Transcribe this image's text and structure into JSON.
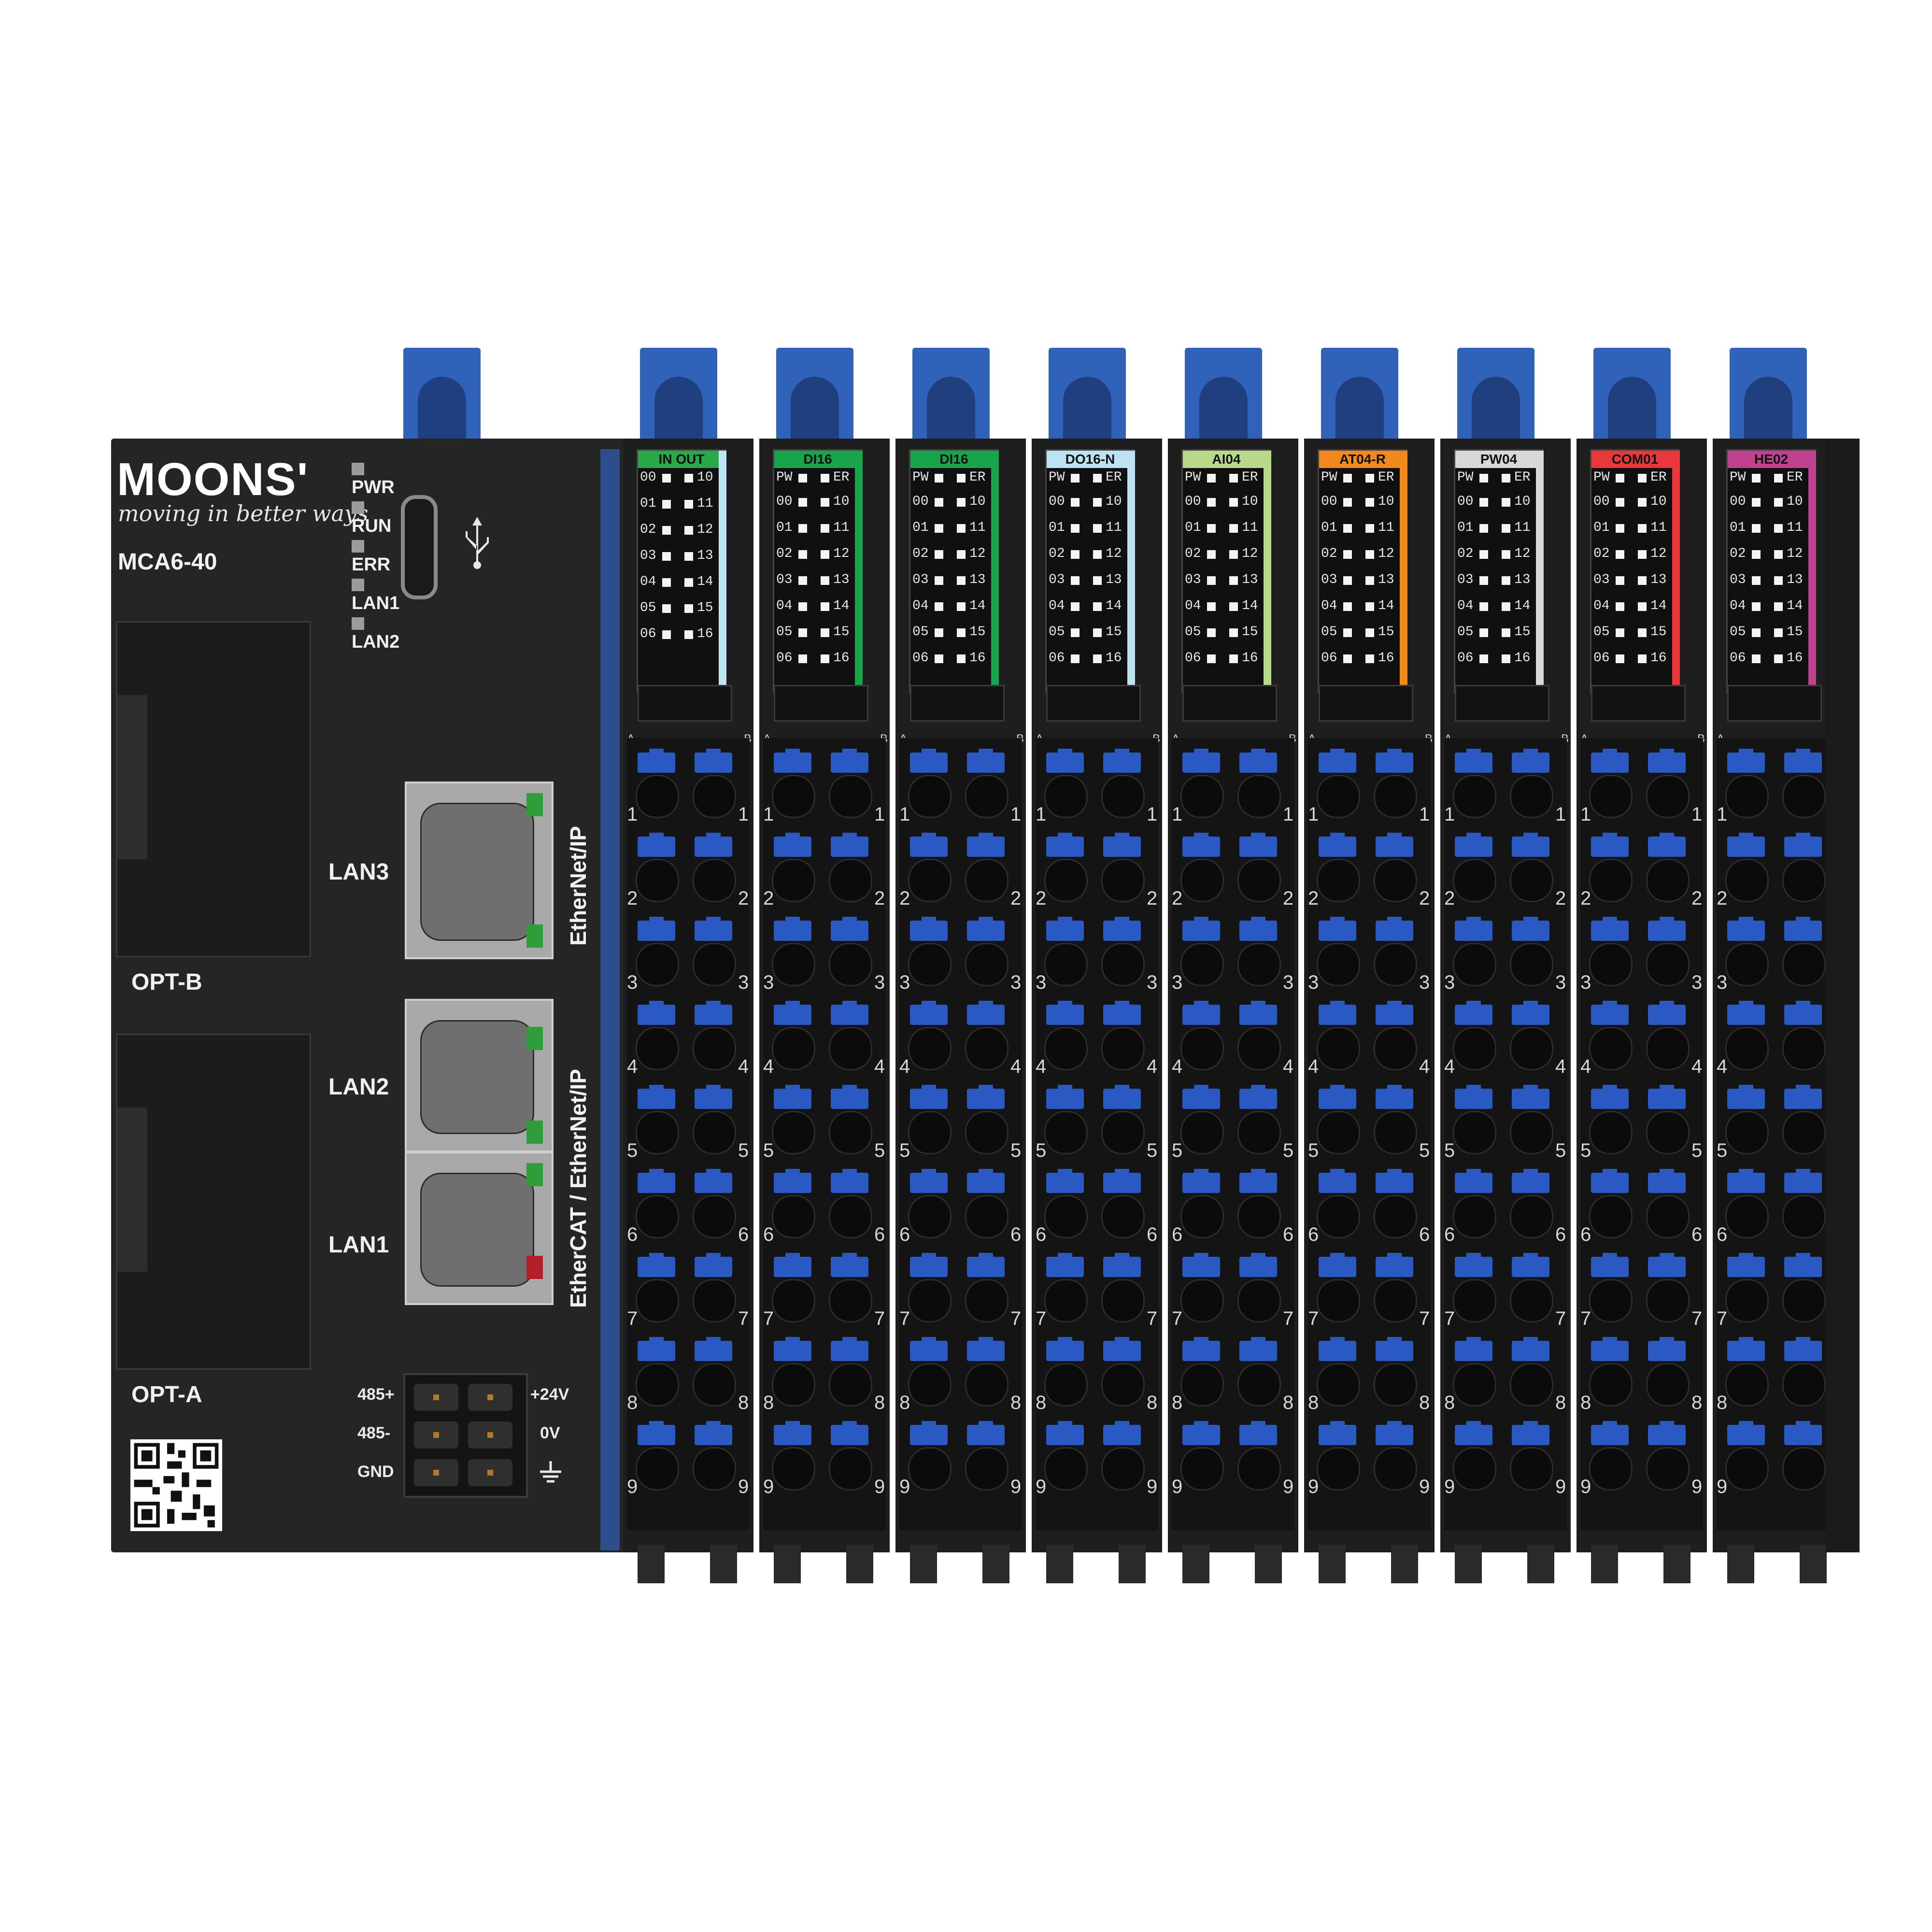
{
  "controller": {
    "brand": "MOONS'",
    "tagline": "moving in better ways",
    "model": "MCA6-40",
    "leds": [
      "PWR",
      "RUN",
      "ERR",
      "LAN1",
      "LAN2"
    ],
    "opt_b": "OPT-B",
    "opt_a": "OPT-A",
    "lan3": "LAN3",
    "lan2": "LAN2",
    "lan1": "LAN1",
    "ethernet_ip": "EtherNet/IP",
    "ethercat_ethernet_ip": "EtherCAT / EtherNet/IP",
    "power_pins_left": [
      "485+",
      "485-",
      "GND"
    ],
    "power_pins_right": [
      "+24V",
      "0V"
    ],
    "usb_icon": "usb-icon",
    "ground_icon": "ground-icon",
    "qr_icon": "qr-code-icon"
  },
  "modules": [
    {
      "label": "IN      OUT",
      "color": "#2aa84a",
      "stripe": "#bfe6f5",
      "left_top": "",
      "right_top": "",
      "io_left": [
        "00",
        "01",
        "02",
        "03",
        "04",
        "05",
        "06"
      ],
      "io_right": [
        "10",
        "11",
        "12",
        "13",
        "14",
        "15",
        "16"
      ]
    },
    {
      "label": "DI16",
      "color": "#17a44a",
      "stripe": "#17a44a",
      "left_top": "PW",
      "right_top": "ER",
      "io_left": [
        "00",
        "01",
        "02",
        "03",
        "04",
        "05",
        "06"
      ],
      "io_right": [
        "10",
        "11",
        "12",
        "13",
        "14",
        "15",
        "16"
      ]
    },
    {
      "label": "DI16",
      "color": "#17a44a",
      "stripe": "#17a44a",
      "left_top": "PW",
      "right_top": "ER",
      "io_left": [
        "00",
        "01",
        "02",
        "03",
        "04",
        "05",
        "06"
      ],
      "io_right": [
        "10",
        "11",
        "12",
        "13",
        "14",
        "15",
        "16"
      ]
    },
    {
      "label": "DO16-N",
      "color": "#bde2f2",
      "stripe": "#bde2f2",
      "left_top": "PW",
      "right_top": "ER",
      "io_left": [
        "00",
        "01",
        "02",
        "03",
        "04",
        "05",
        "06"
      ],
      "io_right": [
        "10",
        "11",
        "12",
        "13",
        "14",
        "15",
        "16"
      ]
    },
    {
      "label": "AI04",
      "color": "#b9d98a",
      "stripe": "#b9d98a",
      "left_top": "PW",
      "right_top": "ER",
      "io_left": [
        "00",
        "01",
        "02",
        "03",
        "04",
        "05",
        "06"
      ],
      "io_right": [
        "10",
        "11",
        "12",
        "13",
        "14",
        "15",
        "16"
      ]
    },
    {
      "label": "AT04-R",
      "color": "#f0891e",
      "stripe": "#f0891e",
      "left_top": "PW",
      "right_top": "ER",
      "io_left": [
        "00",
        "01",
        "02",
        "03",
        "04",
        "05",
        "06"
      ],
      "io_right": [
        "10",
        "11",
        "12",
        "13",
        "14",
        "15",
        "16"
      ]
    },
    {
      "label": "PW04",
      "color": "#d8d8d8",
      "stripe": "#d8d8d8",
      "left_top": "PW",
      "right_top": "ER",
      "io_left": [
        "00",
        "01",
        "02",
        "03",
        "04",
        "05",
        "06"
      ],
      "io_right": [
        "10",
        "11",
        "12",
        "13",
        "14",
        "15",
        "16"
      ]
    },
    {
      "label": "COM01",
      "color": "#e8383b",
      "stripe": "#e8383b",
      "left_top": "PW",
      "right_top": "ER",
      "io_left": [
        "00",
        "01",
        "02",
        "03",
        "04",
        "05",
        "06"
      ],
      "io_right": [
        "10",
        "11",
        "12",
        "13",
        "14",
        "15",
        "16"
      ]
    },
    {
      "label": "HE02",
      "color": "#c0418f",
      "stripe": "#c0418f",
      "left_top": "PW",
      "right_top": "ER",
      "io_left": [
        "00",
        "01",
        "02",
        "03",
        "04",
        "05",
        "06"
      ],
      "io_right": [
        "10",
        "11",
        "12",
        "13",
        "14",
        "15",
        "16"
      ]
    }
  ],
  "terminal_rows": [
    "1",
    "2",
    "3",
    "4",
    "5",
    "6",
    "7",
    "8",
    "9"
  ],
  "terminal_cols": [
    "A",
    "B"
  ],
  "colors": {
    "housing": "#252525",
    "release_button": "#2b59c3",
    "rail_tab": "#2f62b8",
    "led_green": "#2e9e3a",
    "led_red": "#b3202a"
  }
}
